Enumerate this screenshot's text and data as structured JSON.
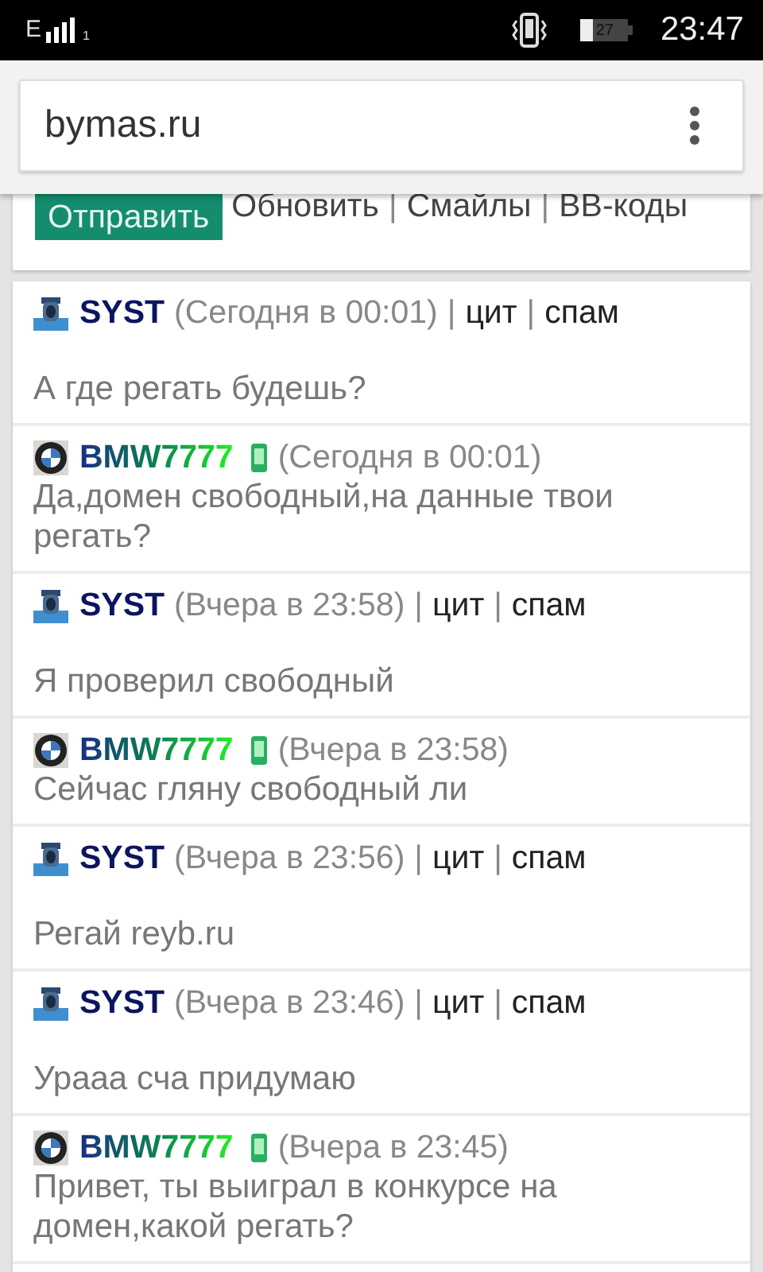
{
  "status_bar": {
    "network": "E",
    "sim": "1",
    "battery": "27",
    "time": "23:47"
  },
  "browser": {
    "url": "bymas.ru"
  },
  "separator": "|",
  "form": {
    "submit": "Отправить",
    "links": [
      "Обновить",
      "Смайлы",
      "BB-коды"
    ]
  },
  "posts": [
    {
      "kind": "staff",
      "author": "SYST",
      "mobile": false,
      "time": "(Сегодня в 00:01)",
      "actions": [
        "цит",
        "спам"
      ],
      "text": "А где регать будешь?"
    },
    {
      "kind": "member",
      "author": "BMW7777",
      "mobile": true,
      "time": "(Сегодня в 00:01)",
      "text": "Да,домен свободный,на данные твои регать?"
    },
    {
      "kind": "staff",
      "author": "SYST",
      "mobile": false,
      "time": "(Вчера в 23:58)",
      "actions": [
        "цит",
        "спам"
      ],
      "text": "Я проверил свободный"
    },
    {
      "kind": "member",
      "author": "BMW7777",
      "mobile": true,
      "time": "(Вчера в 23:58)",
      "text": "Сейчас гляну свободный ли"
    },
    {
      "kind": "staff",
      "author": "SYST",
      "mobile": false,
      "time": "(Вчера в 23:56)",
      "actions": [
        "цит",
        "спам"
      ],
      "text": "Регай reyb.ru"
    },
    {
      "kind": "staff",
      "author": "SYST",
      "mobile": false,
      "time": "(Вчера в 23:46)",
      "actions": [
        "цит",
        "спам"
      ],
      "text": "Урааа сча придумаю"
    },
    {
      "kind": "member",
      "author": "BMW7777",
      "mobile": true,
      "time": "(Вчера в 23:45)",
      "text": "Привет, ты выиграл в конкурсе на домен,какой регать?"
    }
  ]
}
